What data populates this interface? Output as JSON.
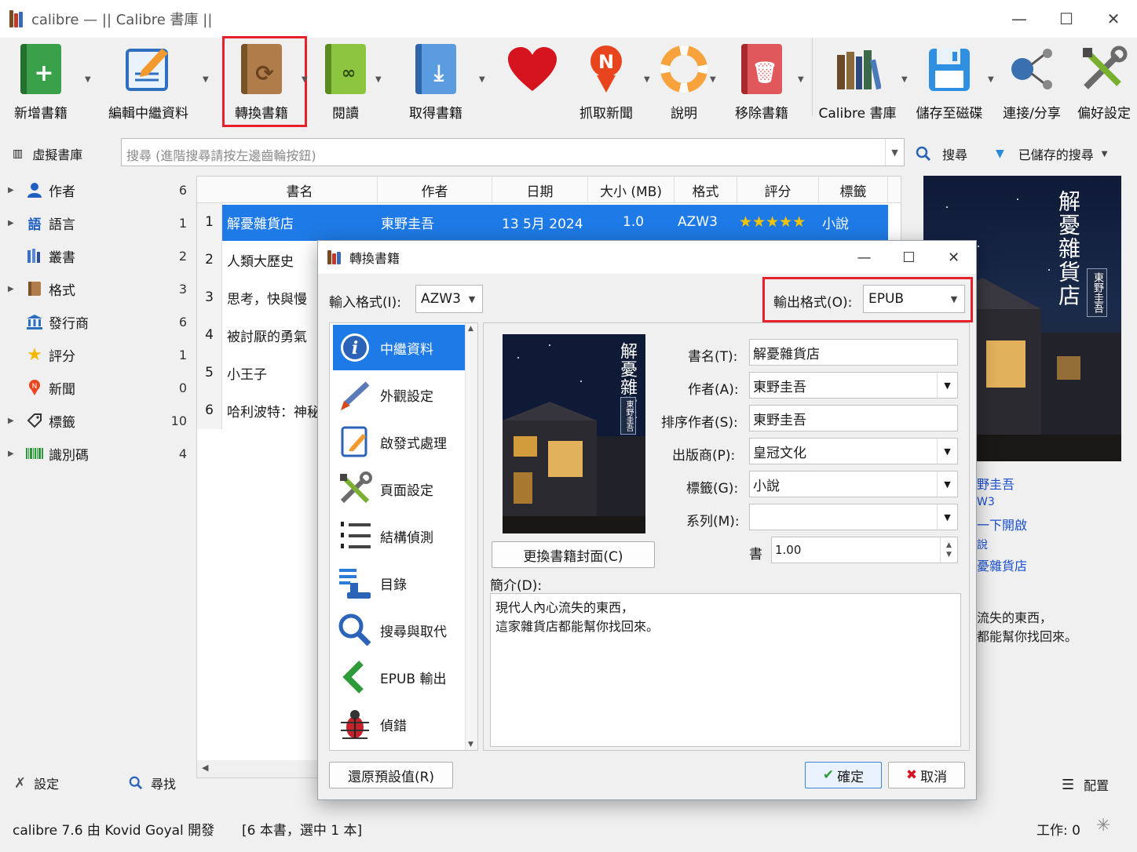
{
  "window": {
    "title": "calibre — || Calibre 書庫 ||",
    "minimize": "—",
    "maximize": "☐",
    "close": "✕"
  },
  "toolbar": {
    "items": [
      {
        "label": "新增書籍",
        "icon": "add-book-icon"
      },
      {
        "label": "編輯中繼資料",
        "icon": "edit-metadata-icon"
      },
      {
        "label": "轉換書籍",
        "icon": "convert-book-icon"
      },
      {
        "label": "閱讀",
        "icon": "read-book-icon"
      },
      {
        "label": "取得書籍",
        "icon": "get-books-icon"
      },
      {
        "label": "",
        "icon": "heart-icon"
      },
      {
        "label": "抓取新聞",
        "icon": "fetch-news-icon"
      },
      {
        "label": "說明",
        "icon": "help-lifebuoy-icon"
      },
      {
        "label": "移除書籍",
        "icon": "remove-book-icon"
      },
      {
        "label": "Calibre 書庫",
        "icon": "library-icon"
      },
      {
        "label": "儲存至磁碟",
        "icon": "save-disk-icon"
      },
      {
        "label": "連接/分享",
        "icon": "connect-share-icon"
      },
      {
        "label": "偏好設定",
        "icon": "preferences-icon"
      }
    ]
  },
  "searchbar": {
    "virtual_library": "虛擬書庫",
    "placeholder": "搜尋 (進階搜尋請按左邊齒輪按鈕)",
    "search_button": "搜尋",
    "saved_searches": "已儲存的搜尋"
  },
  "tag_browser": {
    "items": [
      {
        "label": "作者",
        "count": "6",
        "icon": "person-icon",
        "expandable": true
      },
      {
        "label": "語言",
        "count": "1",
        "icon": "languages-icon",
        "expandable": true
      },
      {
        "label": "叢書",
        "count": "2",
        "icon": "series-icon",
        "expandable": false
      },
      {
        "label": "格式",
        "count": "3",
        "icon": "format-icon",
        "expandable": true
      },
      {
        "label": "發行商",
        "count": "6",
        "icon": "publisher-icon",
        "expandable": false
      },
      {
        "label": "評分",
        "count": "1",
        "icon": "star-icon",
        "expandable": false
      },
      {
        "label": "新聞",
        "count": "0",
        "icon": "news-icon",
        "expandable": false
      },
      {
        "label": "標籤",
        "count": "10",
        "icon": "tag-icon",
        "expandable": true
      },
      {
        "label": "識別碼",
        "count": "4",
        "icon": "barcode-icon",
        "expandable": true
      }
    ],
    "settings": "設定",
    "find": "尋找"
  },
  "book_list": {
    "columns": [
      "書名",
      "作者",
      "日期",
      "大小 (MB)",
      "格式",
      "評分",
      "標籤"
    ],
    "rows": [
      {
        "num": "1",
        "title": "解憂雜貨店",
        "author": "東野圭吾",
        "date": "13 5月 2024",
        "size": "1.0",
        "format": "AZW3",
        "rating": "★★★★★",
        "rating_value": 4.5,
        "tags": "小說"
      },
      {
        "num": "2",
        "title": "人類大歷史"
      },
      {
        "num": "3",
        "title": "思考，快與慢"
      },
      {
        "num": "4",
        "title": "被討厭的勇氣"
      },
      {
        "num": "5",
        "title": "小王子"
      },
      {
        "num": "6",
        "title": "哈利波特：神秘"
      }
    ]
  },
  "right_panel": {
    "cover_title": "解憂雜貨店",
    "cover_author": "東野圭吾",
    "details": [
      "野圭吾",
      "W3",
      "一下開啟",
      "說",
      "憂雜貨店"
    ],
    "comment_lines": [
      "流失的東西，",
      "都能幫你找回來。"
    ],
    "layout_button": "配置"
  },
  "status_bar": {
    "version": "calibre 7.6 由 Kovid Goyal 開發",
    "selection": "[6 本書，選中 1 本]",
    "jobs": "工作: 0"
  },
  "dialog": {
    "title": "轉換書籍",
    "input_format_label": "輸入格式(I):",
    "input_format": "AZW3",
    "output_format_label": "輸出格式(O):",
    "output_format": "EPUB",
    "nav": [
      {
        "label": "中繼資料",
        "icon": "info-icon"
      },
      {
        "label": "外觀設定",
        "icon": "brush-icon"
      },
      {
        "label": "啟發式處理",
        "icon": "edit-document-icon"
      },
      {
        "label": "頁面設定",
        "icon": "tools-icon"
      },
      {
        "label": "結構偵測",
        "icon": "list-icon"
      },
      {
        "label": "目錄",
        "icon": "toc-icon"
      },
      {
        "label": "搜尋與取代",
        "icon": "magnifier-icon"
      },
      {
        "label": "EPUB 輸出",
        "icon": "back-arrow-icon"
      },
      {
        "label": "偵錯",
        "icon": "bug-icon"
      }
    ],
    "fields": {
      "title_label": "書名(T):",
      "title": "解憂雜貨店",
      "author_label": "作者(A):",
      "author": "東野圭吾",
      "author_sort_label": "排序作者(S):",
      "author_sort": "東野圭吾",
      "publisher_label": "出版商(P):",
      "publisher": "皇冠文化",
      "tags_label": "標籤(G):",
      "tags": "小說",
      "series_label": "系列(M):",
      "series": "",
      "series_index_label": "書",
      "series_index": "1.00"
    },
    "change_cover": "更換書籍封面(C)",
    "comments_label": "簡介(D):",
    "comments": [
      "現代人內心流失的東西，",
      "這家雜貨店都能幫你找回來。"
    ],
    "restore_defaults": "還原預設值(R)",
    "ok": "確定",
    "cancel": "取消"
  },
  "colors": {
    "selection": "#1e7ae6",
    "highlight": "#e8202a",
    "link": "#1a4fd0"
  }
}
